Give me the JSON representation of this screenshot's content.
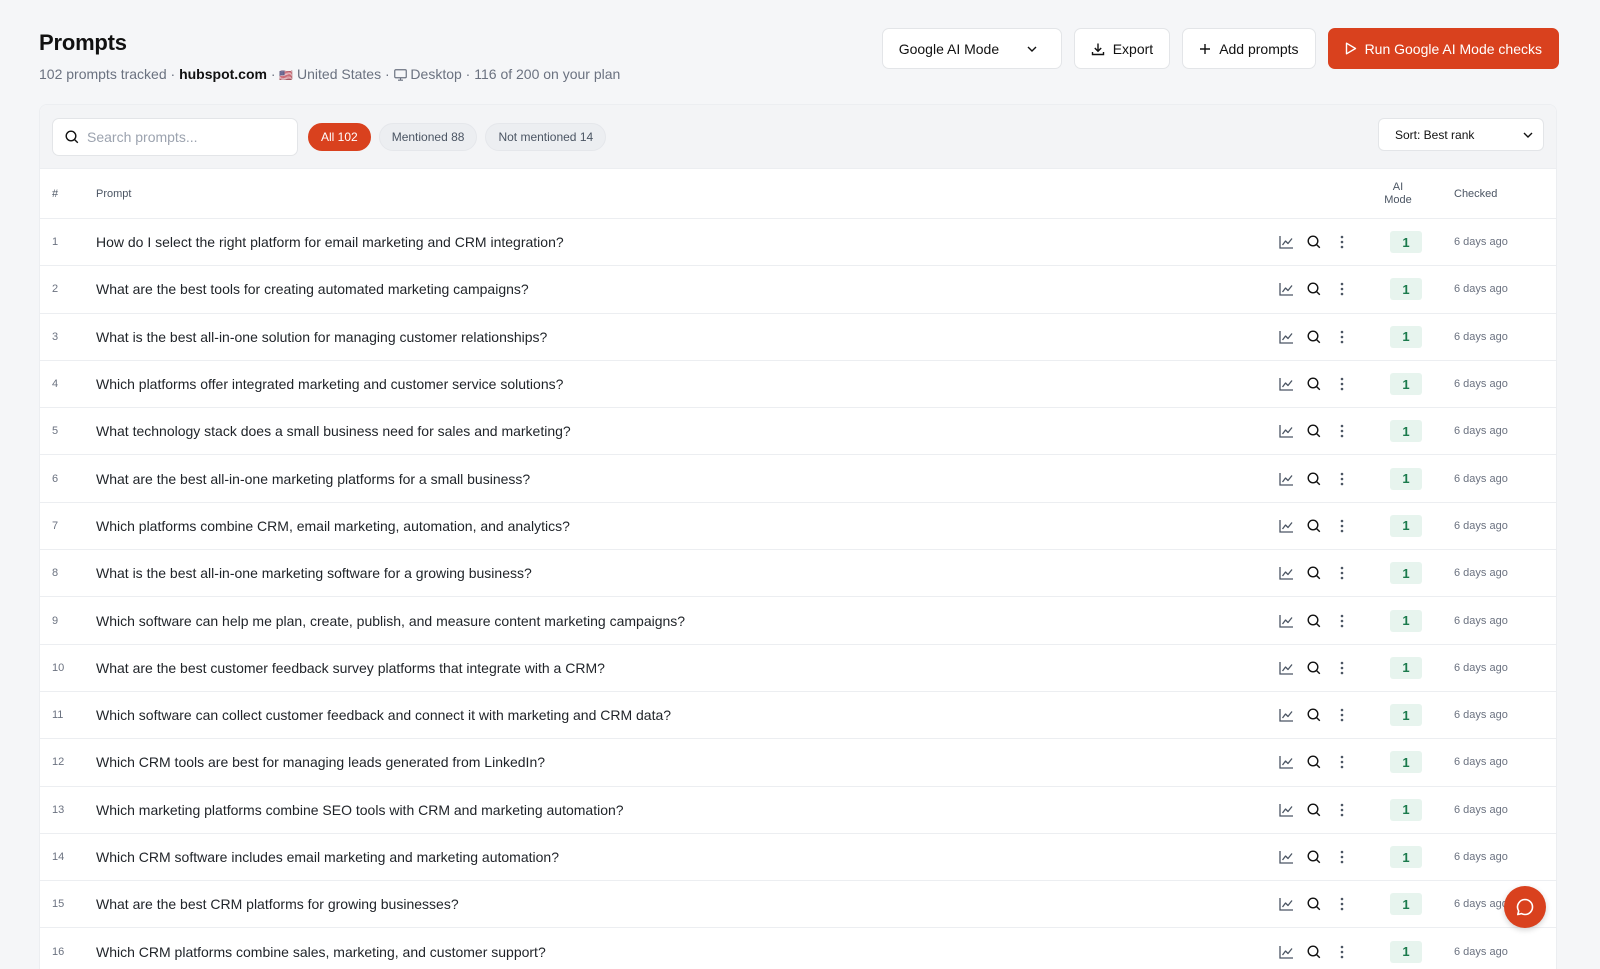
{
  "header": {
    "title": "Prompts",
    "tracked": "102 prompts tracked",
    "domain": "hubspot.com",
    "flag": "🇺🇸",
    "country": "United States",
    "device": "Desktop",
    "plan": "116 of 200 on your plan",
    "sep": "·"
  },
  "actions": {
    "mode_select": "Google AI Mode",
    "export_label": "Export",
    "add_label": "Add prompts",
    "run_label": "Run Google AI Mode checks"
  },
  "toolbar": {
    "search_placeholder": "Search prompts...",
    "filters": [
      {
        "label": "All 102"
      },
      {
        "label": "Mentioned 88"
      },
      {
        "label": "Not mentioned 14"
      }
    ],
    "sort_label": "Sort: Best rank"
  },
  "table": {
    "headers": {
      "num": "#",
      "prompt": "Prompt",
      "ai_line1": "AI",
      "ai_line2": "Mode",
      "checked": "Checked"
    },
    "rows": [
      {
        "num": "1",
        "prompt": "How do I select the right platform for email marketing and CRM integration?",
        "rank": "1",
        "checked": "6 days ago"
      },
      {
        "num": "2",
        "prompt": "What are the best tools for creating automated marketing campaigns?",
        "rank": "1",
        "checked": "6 days ago"
      },
      {
        "num": "3",
        "prompt": "What is the best all-in-one solution for managing customer relationships?",
        "rank": "1",
        "checked": "6 days ago"
      },
      {
        "num": "4",
        "prompt": "Which platforms offer integrated marketing and customer service solutions?",
        "rank": "1",
        "checked": "6 days ago"
      },
      {
        "num": "5",
        "prompt": "What technology stack does a small business need for sales and marketing?",
        "rank": "1",
        "checked": "6 days ago"
      },
      {
        "num": "6",
        "prompt": "What are the best all-in-one marketing platforms for a small business?",
        "rank": "1",
        "checked": "6 days ago"
      },
      {
        "num": "7",
        "prompt": "Which platforms combine CRM, email marketing, automation, and analytics?",
        "rank": "1",
        "checked": "6 days ago"
      },
      {
        "num": "8",
        "prompt": "What is the best all-in-one marketing software for a growing business?",
        "rank": "1",
        "checked": "6 days ago"
      },
      {
        "num": "9",
        "prompt": "Which software can help me plan, create, publish, and measure content marketing campaigns?",
        "rank": "1",
        "checked": "6 days ago"
      },
      {
        "num": "10",
        "prompt": "What are the best customer feedback survey platforms that integrate with a CRM?",
        "rank": "1",
        "checked": "6 days ago"
      },
      {
        "num": "11",
        "prompt": "Which software can collect customer feedback and connect it with marketing and CRM data?",
        "rank": "1",
        "checked": "6 days ago"
      },
      {
        "num": "12",
        "prompt": "Which CRM tools are best for managing leads generated from LinkedIn?",
        "rank": "1",
        "checked": "6 days ago"
      },
      {
        "num": "13",
        "prompt": "Which marketing platforms combine SEO tools with CRM and marketing automation?",
        "rank": "1",
        "checked": "6 days ago"
      },
      {
        "num": "14",
        "prompt": "Which CRM software includes email marketing and marketing automation?",
        "rank": "1",
        "checked": "6 days ago"
      },
      {
        "num": "15",
        "prompt": "What are the best CRM platforms for growing businesses?",
        "rank": "1",
        "checked": "6 days ago"
      },
      {
        "num": "16",
        "prompt": "Which CRM platforms combine sales, marketing, and customer support?",
        "rank": "1",
        "checked": "6 days ago"
      }
    ]
  },
  "colors": {
    "accent": "#d9411e",
    "rank_bg": "#e7f4ee",
    "rank_text": "#1a7a4c"
  },
  "icons": {
    "row": [
      "chart-icon",
      "search-icon",
      "more-vertical-icon"
    ],
    "chat": "chat-bubble-icon"
  }
}
